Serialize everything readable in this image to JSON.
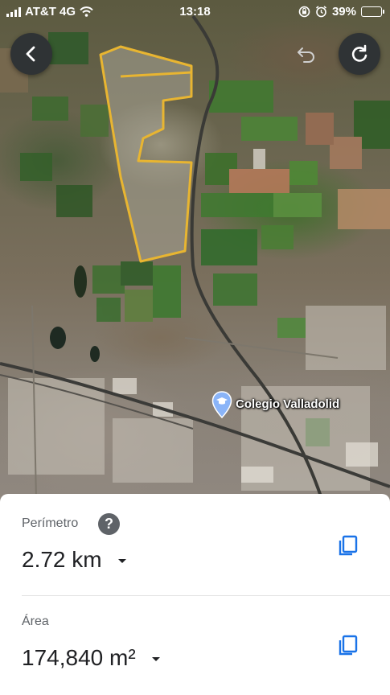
{
  "status_bar": {
    "carrier": "AT&T 4G",
    "time": "13:18",
    "battery_percent": "39%",
    "battery_level": 0.39
  },
  "map": {
    "place_label": "Colegio Valladolid",
    "place_icon": "graduation-cap-pin-icon",
    "boundary_color": "#e8b531"
  },
  "toolbar": {
    "back_icon": "chevron-left-icon",
    "undo_icon": "undo-icon",
    "redo_icon": "redo-icon"
  },
  "measurements": {
    "perimeter_label": "Perímetro",
    "perimeter_value": "2.72 km",
    "area_label": "Área",
    "area_value": "174,840 m²"
  },
  "colors": {
    "sheet_background": "#ffffff",
    "copy_icon": "#1a73e8",
    "button_background": "#2f3335"
  }
}
